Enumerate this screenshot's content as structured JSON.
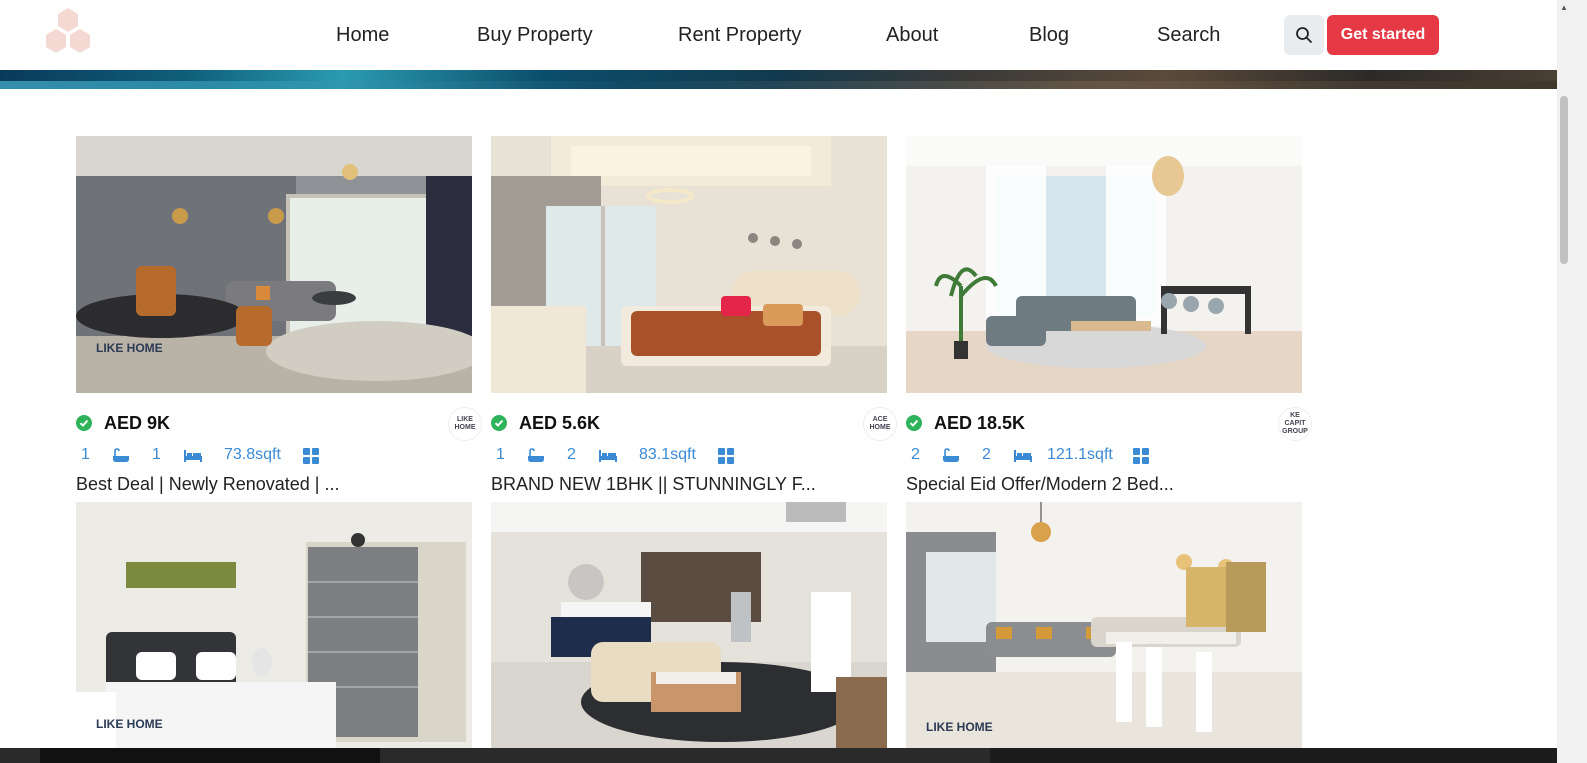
{
  "brand": {
    "logo_icon": "hexagon-logo-icon"
  },
  "nav": {
    "items": [
      {
        "label": "Home"
      },
      {
        "label": "Buy Property"
      },
      {
        "label": "Rent Property"
      },
      {
        "label": "About"
      },
      {
        "label": "Blog"
      },
      {
        "label": "Search"
      }
    ],
    "search_icon": "search-icon",
    "cta_label": "Get started"
  },
  "colors": {
    "accent": "#e63946",
    "link_blue": "#3b8bd4",
    "verified_green": "#2fb35a"
  },
  "listings": [
    {
      "price": "AED 9K",
      "baths": "1",
      "beds": "1",
      "area": "73.8sqft",
      "title": "Best Deal | Newly Renovated | ...",
      "agent": "LIKE HOME",
      "watermark": "LIKE HOME"
    },
    {
      "price": "AED 5.6K",
      "baths": "1",
      "beds": "2",
      "area": "83.1sqft",
      "title": "BRAND NEW 1BHK || STUNNINGLY F...",
      "agent": "ACE HOME"
    },
    {
      "price": "AED 18.5K",
      "baths": "2",
      "beds": "2",
      "area": "121.1sqft",
      "title": "Special Eid Offer/Modern 2 Bed...",
      "agent": "KE CAPIT GROUP"
    },
    {
      "watermark": "LIKE HOME"
    },
    {},
    {
      "watermark": "LIKE HOME"
    }
  ]
}
